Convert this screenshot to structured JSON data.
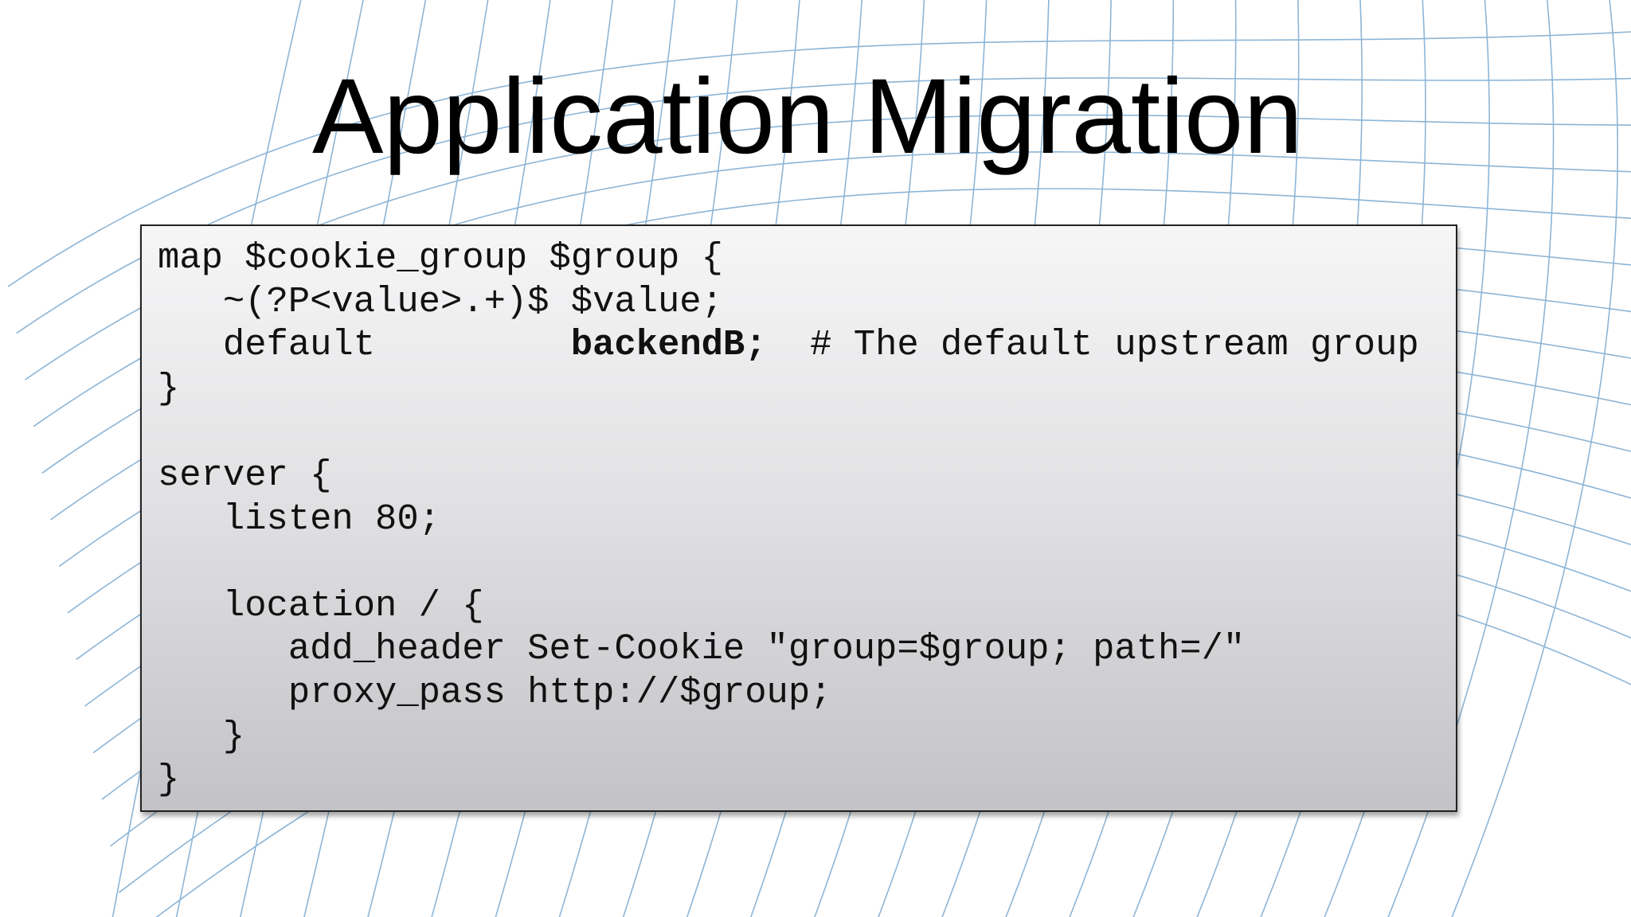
{
  "slide": {
    "title": "Application Migration",
    "code_lines": [
      [
        {
          "text": "map $cookie_group $group {"
        }
      ],
      [
        {
          "text": "   ~(?P<value>.+)$ $value;"
        }
      ],
      [
        {
          "text": "   default         "
        },
        {
          "text": "backendB;",
          "bold": true
        },
        {
          "text": "  # The default upstream group"
        }
      ],
      [
        {
          "text": "}"
        }
      ],
      [
        {
          "text": ""
        }
      ],
      [
        {
          "text": "server {"
        }
      ],
      [
        {
          "text": "   listen 80;"
        }
      ],
      [
        {
          "text": ""
        }
      ],
      [
        {
          "text": "   location / {"
        }
      ],
      [
        {
          "text": "      add_header Set-Cookie \"group=$group; path=/\""
        }
      ],
      [
        {
          "text": "      proxy_pass http://$group;"
        }
      ],
      [
        {
          "text": "   }"
        }
      ],
      [
        {
          "text": "}"
        }
      ]
    ]
  },
  "colors": {
    "mesh_line": "#7aa9cf",
    "title_text": "#000000",
    "code_text": "#111111",
    "box_border": "#222222"
  }
}
